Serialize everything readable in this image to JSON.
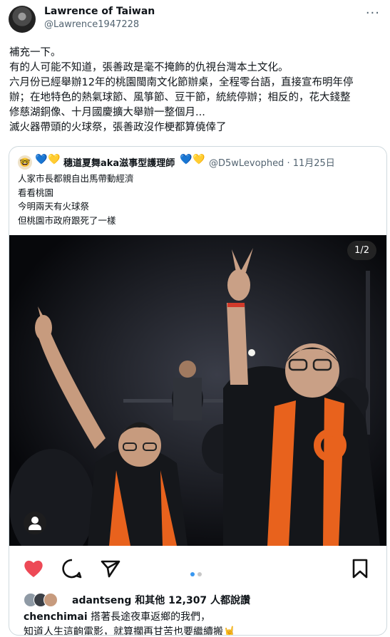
{
  "tweet": {
    "author_name": "Lawrence of Taiwan",
    "author_handle": "@Lawrence1947228",
    "more_icon": "more-horizontal-icon",
    "lines": [
      "補充一下。",
      "有的人可能不知道，張善政是毫不掩飾的仇視台灣本土文化。",
      "六月份已經舉辦12年的桃園閩南文化節辦桌，全程零台語，直接宣布明年停",
      "辦；在地特色的熱氣球節、風箏節、豆干節，統統停辦；相反的，花大錢整",
      "修慈湖銅像、十月國慶擴大舉辦一整個月...",
      "滅火器帶頭的火球祭，張善政沒作梗都算僥倖了"
    ]
  },
  "quote": {
    "name": "穗道夏舞aka滋事型護理師",
    "name_prefix_emojis": [
      "💙",
      "💛"
    ],
    "name_suffix_emojis": [
      "💙",
      "💛"
    ],
    "handle_date": "@D5wLevophed · 11月25日",
    "lines": [
      "人家市長都親自出馬帶動經濟",
      "看看桃園",
      "今明兩天有火球祭",
      "但桃園市政府跟死了一樣"
    ],
    "photo": {
      "counter": "1/2",
      "accent_orange": "#e8621d"
    },
    "post": {
      "liked_by_user": "adantseng",
      "likes_text": " 和其他 12,307 人都說讚",
      "caption_user": "chenchimai",
      "caption_line1": " 搭著長途夜車返鄉的我們，",
      "caption_line2": "知道人生這齣電影，就算擱再甘苦也要繼續搬",
      "caption_emoji": "🤘",
      "heart_color": "#ed4956",
      "dot_active_color": "#3897f0"
    }
  }
}
